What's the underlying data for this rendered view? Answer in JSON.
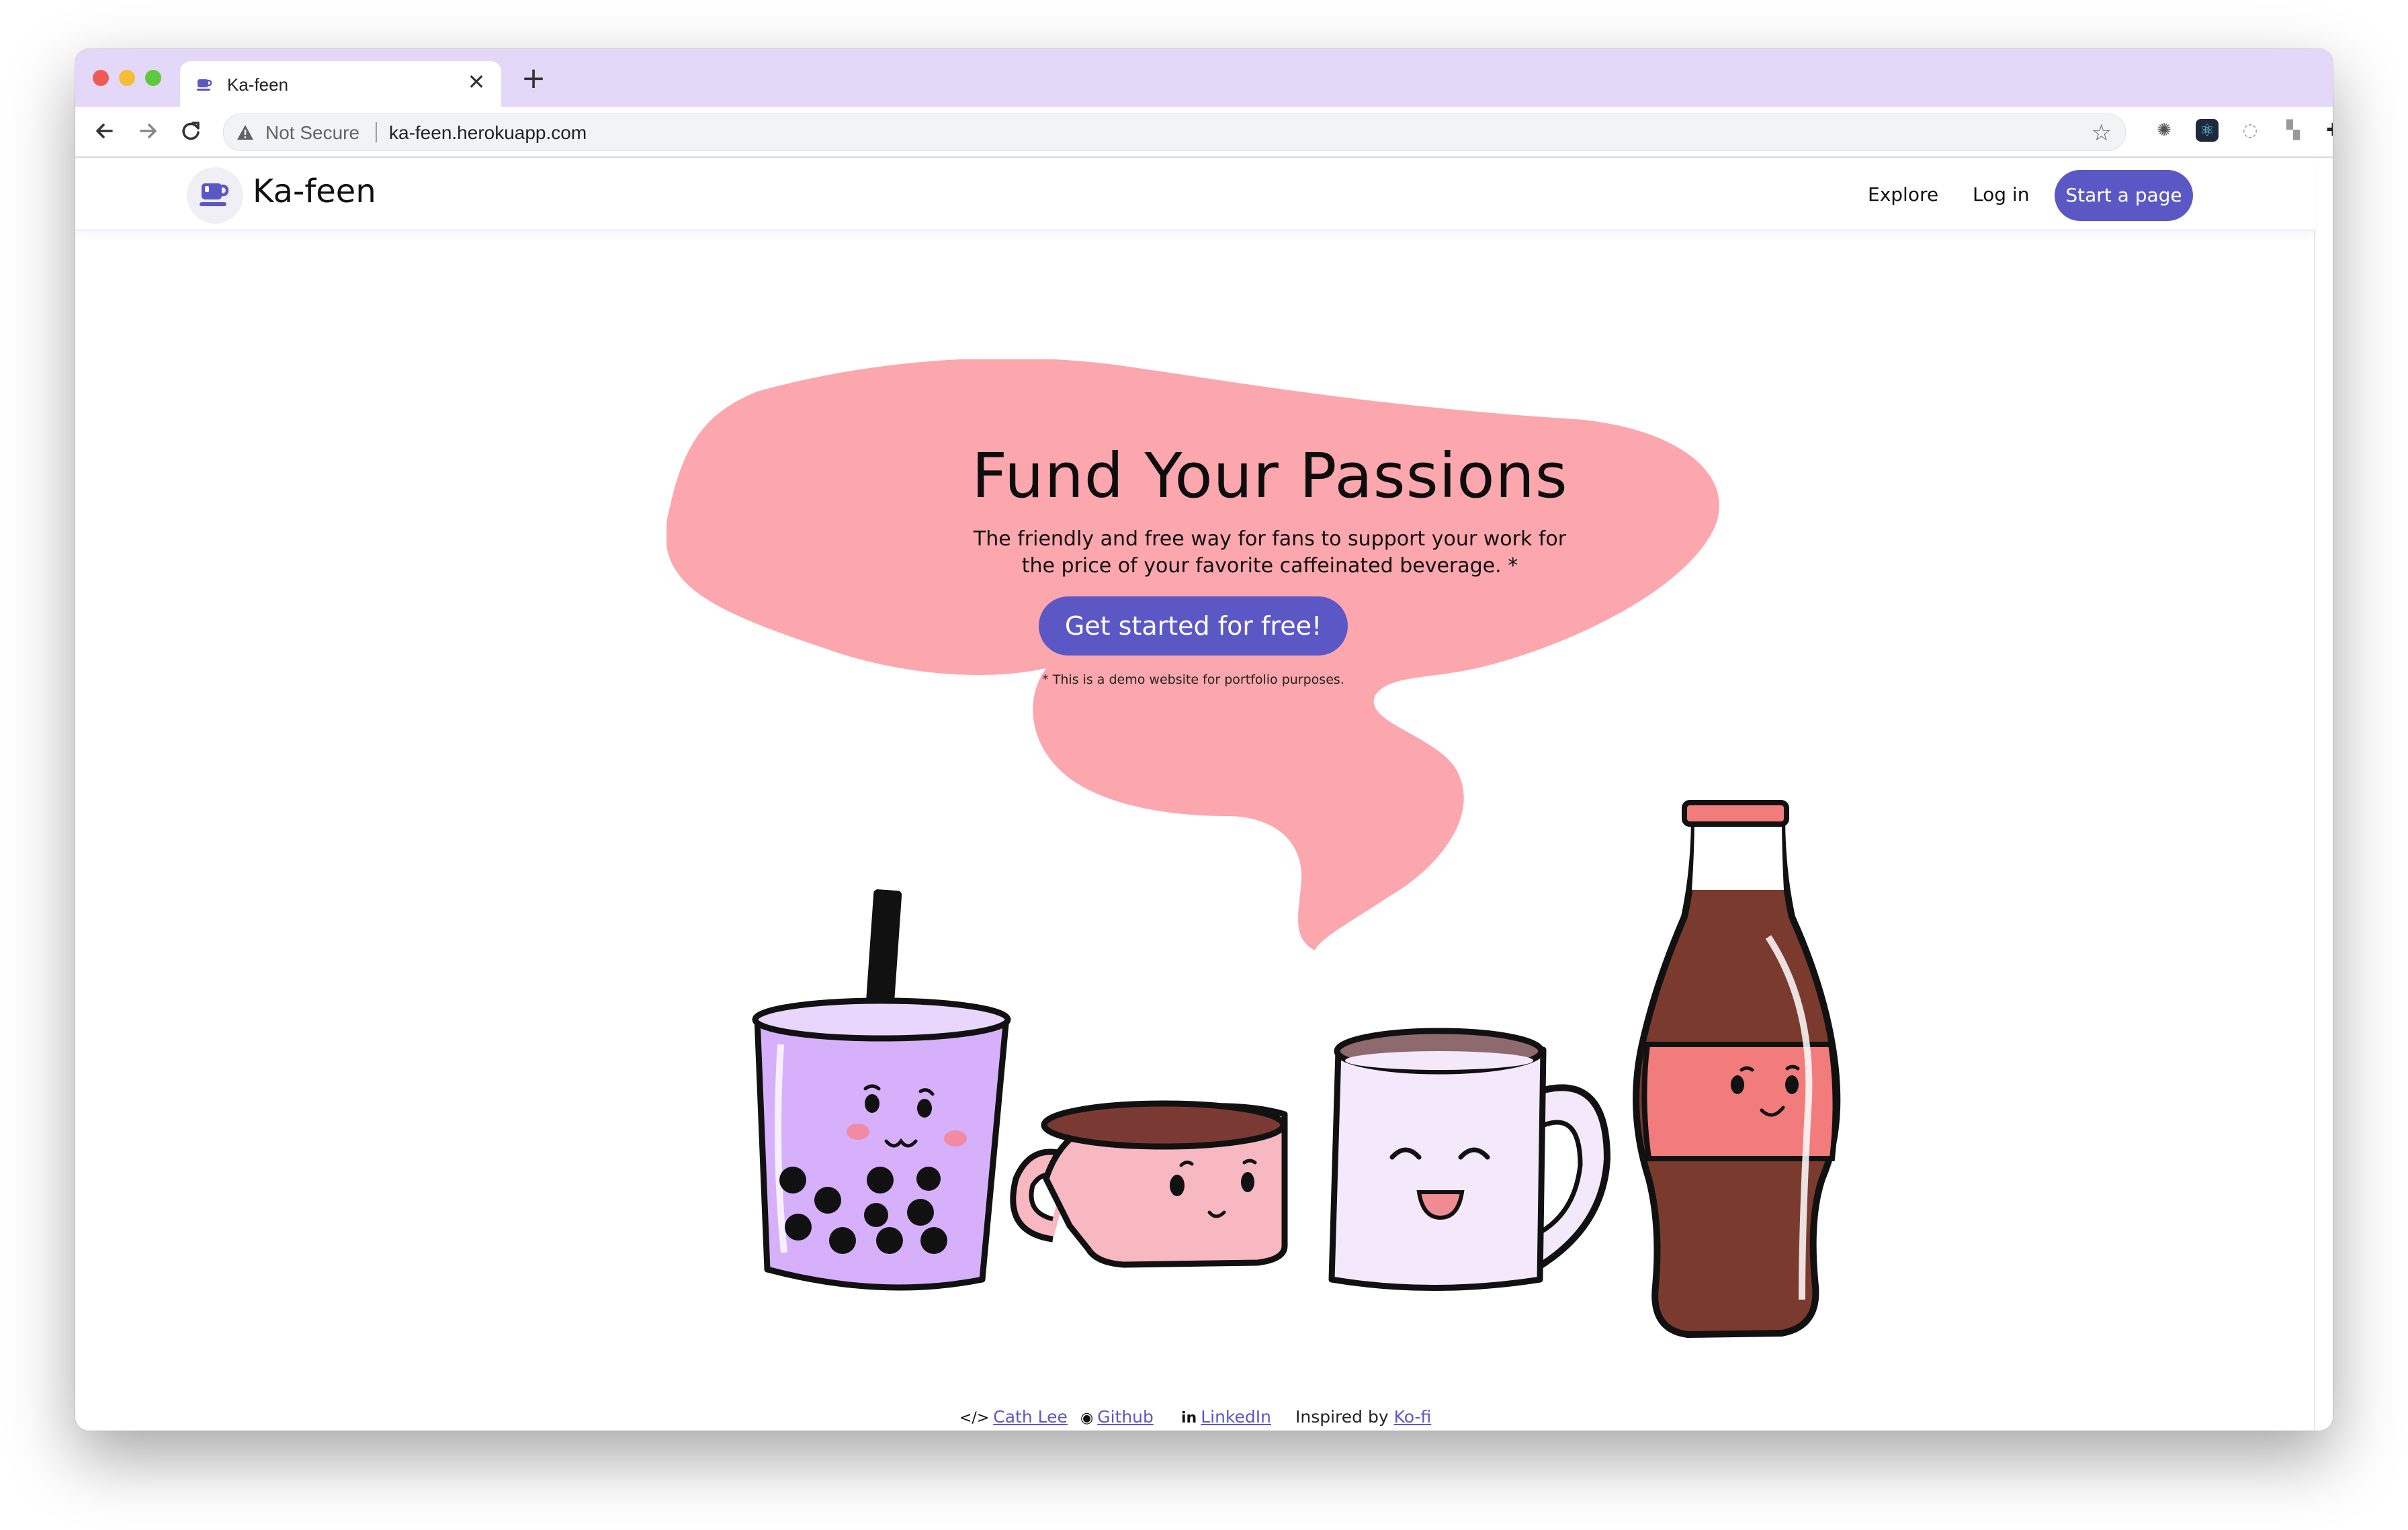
{
  "browser": {
    "tab_title": "Ka-feen",
    "tab_close": "✕",
    "new_tab": "+",
    "security_label": "Not Secure",
    "url": "ka-feen.herokuapp.com",
    "icons": {
      "back": "back-arrow-icon",
      "forward": "forward-arrow-icon",
      "reload": "reload-icon",
      "bookmark": "star-icon"
    }
  },
  "header": {
    "brand": "Ka-feen",
    "nav": {
      "explore": "Explore",
      "login": "Log in",
      "start": "Start a page"
    }
  },
  "hero": {
    "title": "Fund Your Passions",
    "subtitle_line1": "The friendly and free way for fans to support your work for",
    "subtitle_line2": "the price of your favorite caffeinated beverage. *",
    "cta": "Get started for free!",
    "disclaimer": "* This is a demo website for portfolio purposes."
  },
  "footer": {
    "author": "Cath Lee",
    "github": "Github",
    "linkedin": "LinkedIn",
    "inspired_prefix": "Inspired by",
    "inspired_link": "Ko-fi"
  },
  "colors": {
    "accent": "#5b58c6",
    "blob": "#fca6ad",
    "titlebar": "#e4d8f8"
  }
}
